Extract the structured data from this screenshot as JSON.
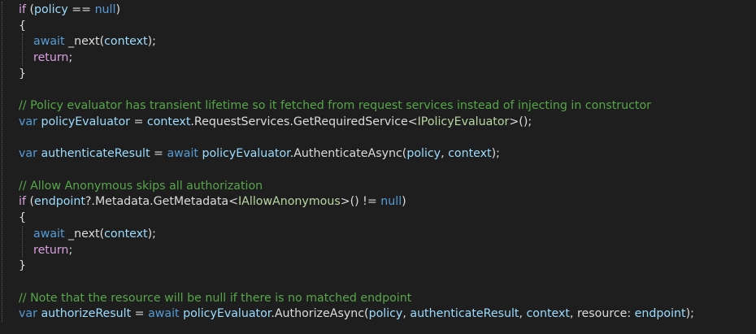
{
  "editor": {
    "language": "C#",
    "colors": {
      "background": "#1e1e1e",
      "plain": "#dcdcdc",
      "keyword": "#569cd6",
      "control": "#d8a0df",
      "variable": "#9cdcfe",
      "type": "#b8d7a3",
      "comment": "#57a64a"
    },
    "lines": [
      [
        [
          "ctl",
          "if"
        ],
        [
          "plain",
          " ("
        ],
        [
          "var",
          "policy"
        ],
        [
          "plain",
          " == "
        ],
        [
          "kw",
          "null"
        ],
        [
          "plain",
          ")"
        ]
      ],
      [
        [
          "plain",
          "{"
        ]
      ],
      [
        [
          "plain",
          "    "
        ],
        [
          "kw",
          "await"
        ],
        [
          "plain",
          " _next("
        ],
        [
          "var",
          "context"
        ],
        [
          "plain",
          ");"
        ]
      ],
      [
        [
          "plain",
          "    "
        ],
        [
          "ctl",
          "return"
        ],
        [
          "plain",
          ";"
        ]
      ],
      [
        [
          "plain",
          "}"
        ]
      ],
      [],
      [
        [
          "cmt",
          "// Policy evaluator has transient lifetime so it fetched from request services instead of injecting in constructor"
        ]
      ],
      [
        [
          "kw",
          "var"
        ],
        [
          "plain",
          " "
        ],
        [
          "var",
          "policyEvaluator"
        ],
        [
          "plain",
          " = "
        ],
        [
          "var",
          "context"
        ],
        [
          "plain",
          ".RequestServices.GetRequiredService<"
        ],
        [
          "type",
          "IPolicyEvaluator"
        ],
        [
          "plain",
          ">();"
        ]
      ],
      [],
      [
        [
          "kw",
          "var"
        ],
        [
          "plain",
          " "
        ],
        [
          "var",
          "authenticateResult"
        ],
        [
          "plain",
          " = "
        ],
        [
          "kw",
          "await"
        ],
        [
          "plain",
          " "
        ],
        [
          "var",
          "policyEvaluator"
        ],
        [
          "plain",
          ".AuthenticateAsync("
        ],
        [
          "var",
          "policy"
        ],
        [
          "plain",
          ", "
        ],
        [
          "var",
          "context"
        ],
        [
          "plain",
          ");"
        ]
      ],
      [],
      [
        [
          "cmt",
          "// Allow Anonymous skips all authorization"
        ]
      ],
      [
        [
          "ctl",
          "if"
        ],
        [
          "plain",
          " ("
        ],
        [
          "var",
          "endpoint"
        ],
        [
          "plain",
          "?.Metadata.GetMetadata<"
        ],
        [
          "type",
          "IAllowAnonymous"
        ],
        [
          "plain",
          ">() != "
        ],
        [
          "kw",
          "null"
        ],
        [
          "plain",
          ")"
        ]
      ],
      [
        [
          "plain",
          "{"
        ]
      ],
      [
        [
          "plain",
          "    "
        ],
        [
          "kw",
          "await"
        ],
        [
          "plain",
          " _next("
        ],
        [
          "var",
          "context"
        ],
        [
          "plain",
          ");"
        ]
      ],
      [
        [
          "plain",
          "    "
        ],
        [
          "ctl",
          "return"
        ],
        [
          "plain",
          ";"
        ]
      ],
      [
        [
          "plain",
          "}"
        ]
      ],
      [],
      [
        [
          "cmt",
          "// Note that the resource will be null if there is no matched endpoint"
        ]
      ],
      [
        [
          "kw",
          "var"
        ],
        [
          "plain",
          " "
        ],
        [
          "var",
          "authorizeResult"
        ],
        [
          "plain",
          " = "
        ],
        [
          "kw",
          "await"
        ],
        [
          "plain",
          " "
        ],
        [
          "var",
          "policyEvaluator"
        ],
        [
          "plain",
          ".AuthorizeAsync("
        ],
        [
          "var",
          "policy"
        ],
        [
          "plain",
          ", "
        ],
        [
          "var",
          "authenticateResult"
        ],
        [
          "plain",
          ", "
        ],
        [
          "var",
          "context"
        ],
        [
          "plain",
          ", resource: "
        ],
        [
          "var",
          "endpoint"
        ],
        [
          "plain",
          ");"
        ]
      ]
    ]
  }
}
